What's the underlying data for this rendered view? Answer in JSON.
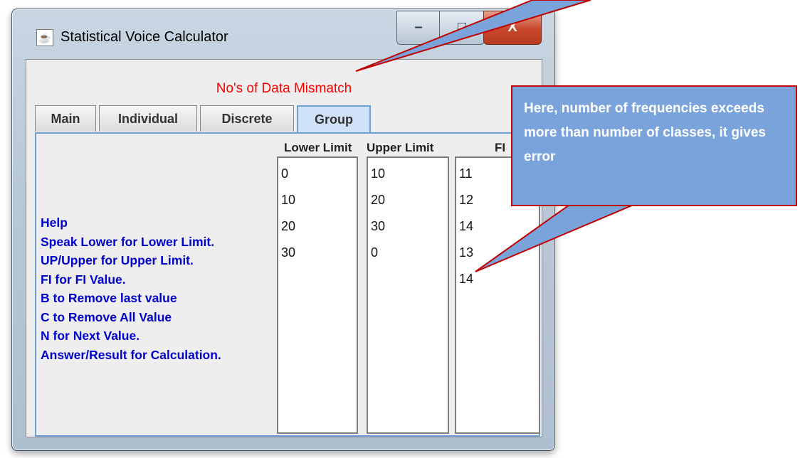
{
  "window": {
    "title": "Statistical Voice Calculator",
    "controls": {
      "minimize": "–",
      "maximize": "□",
      "close": "X"
    }
  },
  "status": {
    "message": "No's of Data Mismatch"
  },
  "tabs": [
    {
      "label": "Main"
    },
    {
      "label": "Individual"
    },
    {
      "label": "Discrete"
    },
    {
      "label": "Group"
    }
  ],
  "columns": {
    "lower": {
      "header": "Lower Limit",
      "values": [
        "0",
        "10",
        "20",
        "30"
      ]
    },
    "upper": {
      "header": "Upper Limit",
      "values": [
        "10",
        "20",
        "30",
        "0"
      ]
    },
    "fi": {
      "header": "FI",
      "values": [
        "11",
        "12",
        "14",
        "13",
        "14"
      ]
    }
  },
  "help": {
    "lines": [
      "Help",
      "Speak Lower for Lower Limit.",
      "UP/Upper for Upper Limit.",
      "FI for FI Value.",
      "B to Remove last value",
      "C to Remove All Value",
      "N for Next Value.",
      "Answer/Result for Calculation."
    ]
  },
  "callout": {
    "text": "Here, number of frequencies exceeds more than number of classes, it gives error"
  },
  "colors": {
    "status": "#ff0000",
    "help_text": "#0000cc",
    "callout_fill": "#7aa3dc",
    "callout_border": "#c00000"
  }
}
